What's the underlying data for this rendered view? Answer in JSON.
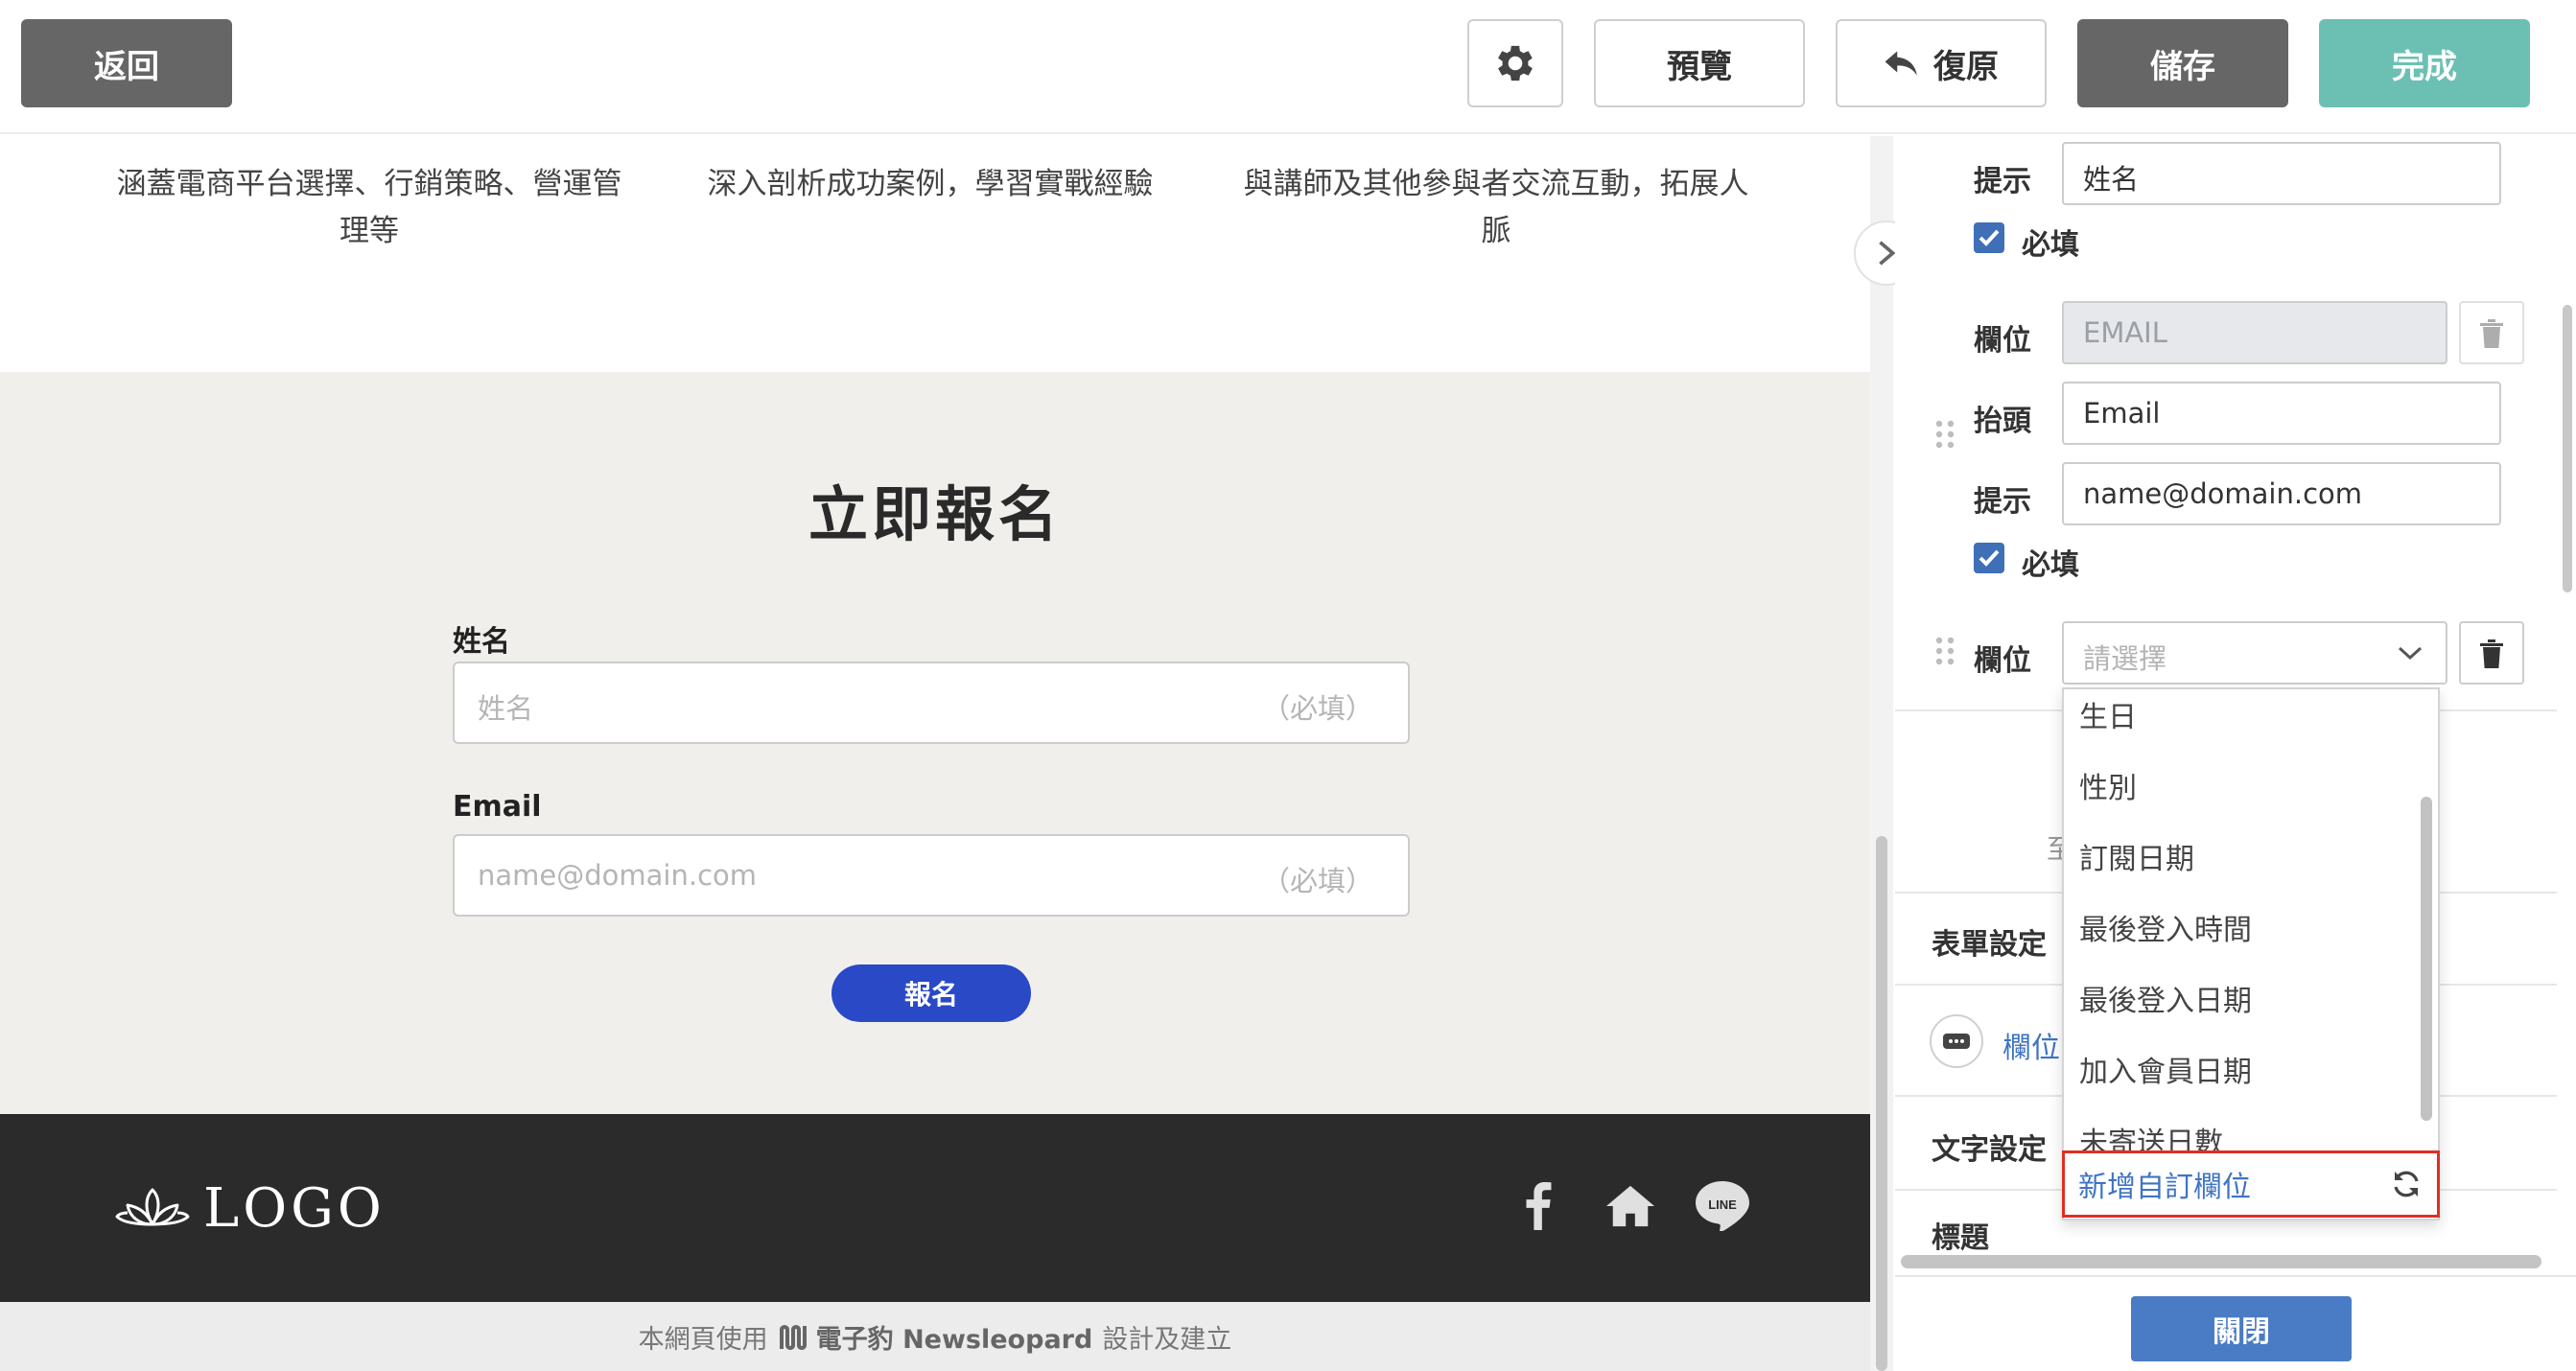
{
  "toolbar": {
    "back_label": "返回",
    "settings_icon": "gear-icon",
    "preview_label": "預覽",
    "undo_label": "復原",
    "save_label": "儲存",
    "done_label": "完成"
  },
  "preview": {
    "features": [
      "涵蓋電商平台選擇、行銷策略、營運管理等",
      "深入剖析成功案例，學習實戰經驗",
      "與講師及其他參與者交流互動，拓展人脈"
    ],
    "registration": {
      "title": "立即報名",
      "fields": [
        {
          "label": "姓名",
          "placeholder": "姓名",
          "required": "（必填）"
        },
        {
          "label": "Email",
          "placeholder": "name@domain.com",
          "required": "（必填）"
        }
      ],
      "submit_label": "報名"
    },
    "footer": {
      "logo_text": "LOGO",
      "social_icons": [
        "facebook-icon",
        "home-icon",
        "line-icon"
      ]
    },
    "credit": {
      "prefix": "本網頁使用",
      "brand": "電子豹 Newsleopard",
      "suffix": "設計及建立"
    }
  },
  "panel": {
    "field1": {
      "hint_label": "提示",
      "hint_value": "姓名",
      "required_label": "必填"
    },
    "field2": {
      "field_label": "欄位",
      "field_value": "EMAIL",
      "header_label": "抬頭",
      "header_value": "Email",
      "hint_label": "提示",
      "hint_value": "name@domain.com",
      "required_label": "必填"
    },
    "field3": {
      "field_label": "欄位",
      "select_placeholder": "請選擇"
    },
    "partial_text": "至",
    "form_settings": "表單設定",
    "field_link": "欄位",
    "text_settings": "文字設定",
    "title_label": "標題",
    "close_label": "關閉"
  },
  "dropdown": {
    "options": [
      "生日",
      "性別",
      "訂閱日期",
      "最後登入時間",
      "最後登入日期",
      "加入會員日期",
      "未寄送日數"
    ],
    "custom_label": "新增自訂欄位"
  },
  "colors": {
    "accent_teal": "#6cc0b3",
    "button_gray": "#666666",
    "submit_blue": "#2949c6",
    "panel_blue": "#4a7bc5",
    "highlight_red": "#e02f22"
  }
}
